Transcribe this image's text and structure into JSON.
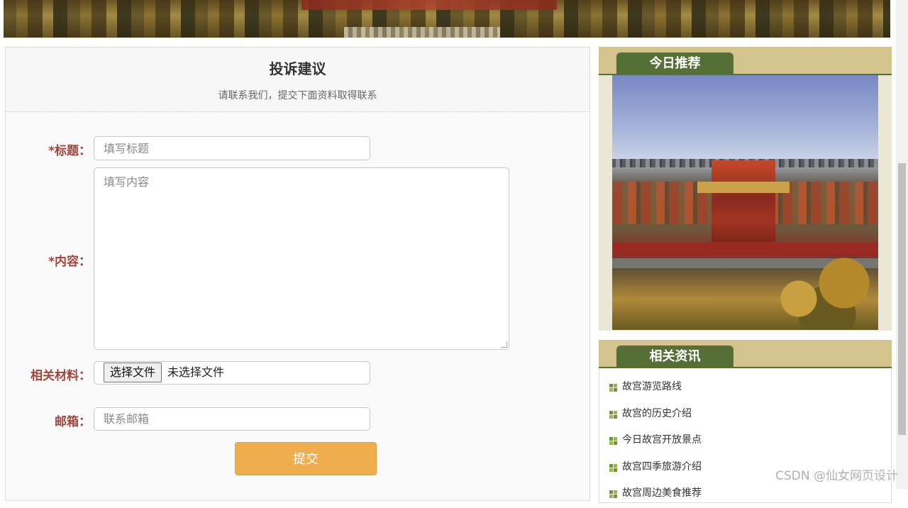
{
  "form": {
    "title": "投诉建议",
    "subtitle": "请联系我们，提交下面资料取得联系",
    "title_label": "*标题：",
    "title_placeholder": "填写标题",
    "content_label": "*内容：",
    "content_placeholder": "填写内容",
    "material_label": "相关材料：",
    "file_button": "选择文件",
    "file_status": "未选择文件",
    "email_label": "邮箱：",
    "email_placeholder": "联系邮箱",
    "submit": "提交"
  },
  "sidebar": {
    "recommend_title": "今日推荐",
    "news_title": "相关资讯",
    "news": [
      "故宫游览路线",
      "故宫的历史介绍",
      "今日故宫开放景点",
      "故宫四季旅游介绍",
      "故宫周边美食推荐"
    ]
  },
  "watermark": "CSDN @仙女网页设计",
  "colors": {
    "accent": "#f0ad4e",
    "label": "#a0453a",
    "tab": "#566f36",
    "tab_bar": "#d3c48d"
  }
}
